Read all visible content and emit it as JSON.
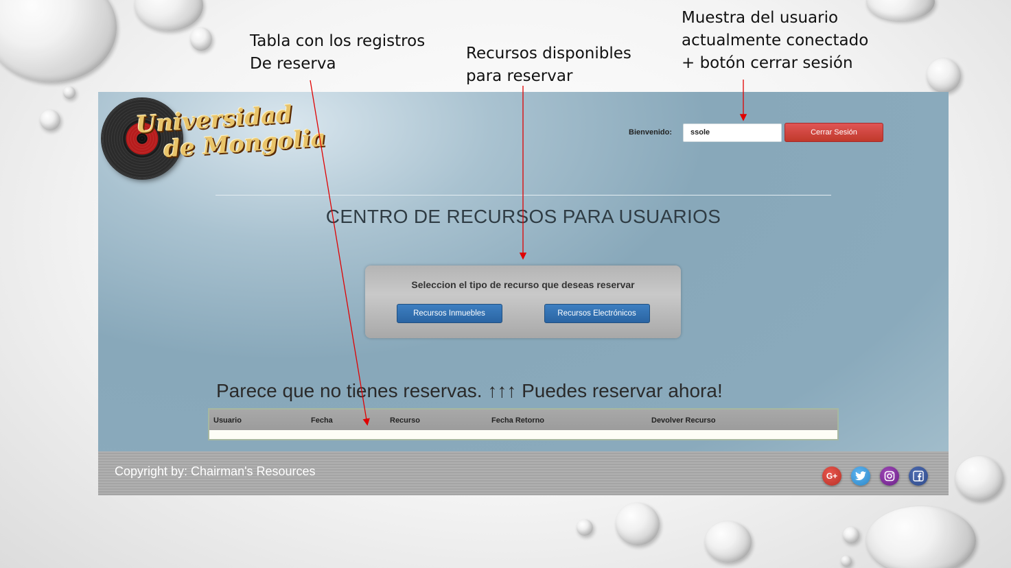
{
  "annotations": {
    "table_note": [
      "Tabla con los registros",
      "De reserva"
    ],
    "resources_note": [
      "Recursos disponibles",
      "para reservar"
    ],
    "user_note": [
      "Muestra del usuario",
      "actualmente conectado",
      "+ botón cerrar sesión"
    ]
  },
  "header": {
    "logo": {
      "line1": "Universidad",
      "line2": "de Mongolia"
    },
    "welcome_label": "Bienvenido:",
    "username": "ssole",
    "logout_label": "Cerrar Sesión"
  },
  "main": {
    "title": "CENTRO DE RECURSOS PARA USUARIOS",
    "panel": {
      "title": "Seleccion el tipo de recurso que deseas reservar",
      "buttons": [
        "Recursos Inmuebles",
        "Recursos Electrónicos"
      ]
    },
    "no_reservations": "Parece que no tienes reservas. ↑↑↑ Puedes reservar ahora!",
    "table": {
      "columns": [
        "Usuario",
        "Fecha",
        "Recurso",
        "Fecha Retorno",
        "Devolver Recurso"
      ],
      "rows": []
    }
  },
  "footer": {
    "copyright": "Copyright by: Chairman's Resources",
    "social": [
      {
        "icon": "google-plus-icon",
        "glyph": "G+"
      },
      {
        "icon": "twitter-icon",
        "glyph": "🐦"
      },
      {
        "icon": "instagram-icon",
        "glyph": "◎"
      },
      {
        "icon": "facebook-icon",
        "glyph": "f"
      }
    ]
  },
  "colors": {
    "logout_button": "#c0392b",
    "action_button": "#2a64a3",
    "annotation_arrow": "#e00000"
  }
}
